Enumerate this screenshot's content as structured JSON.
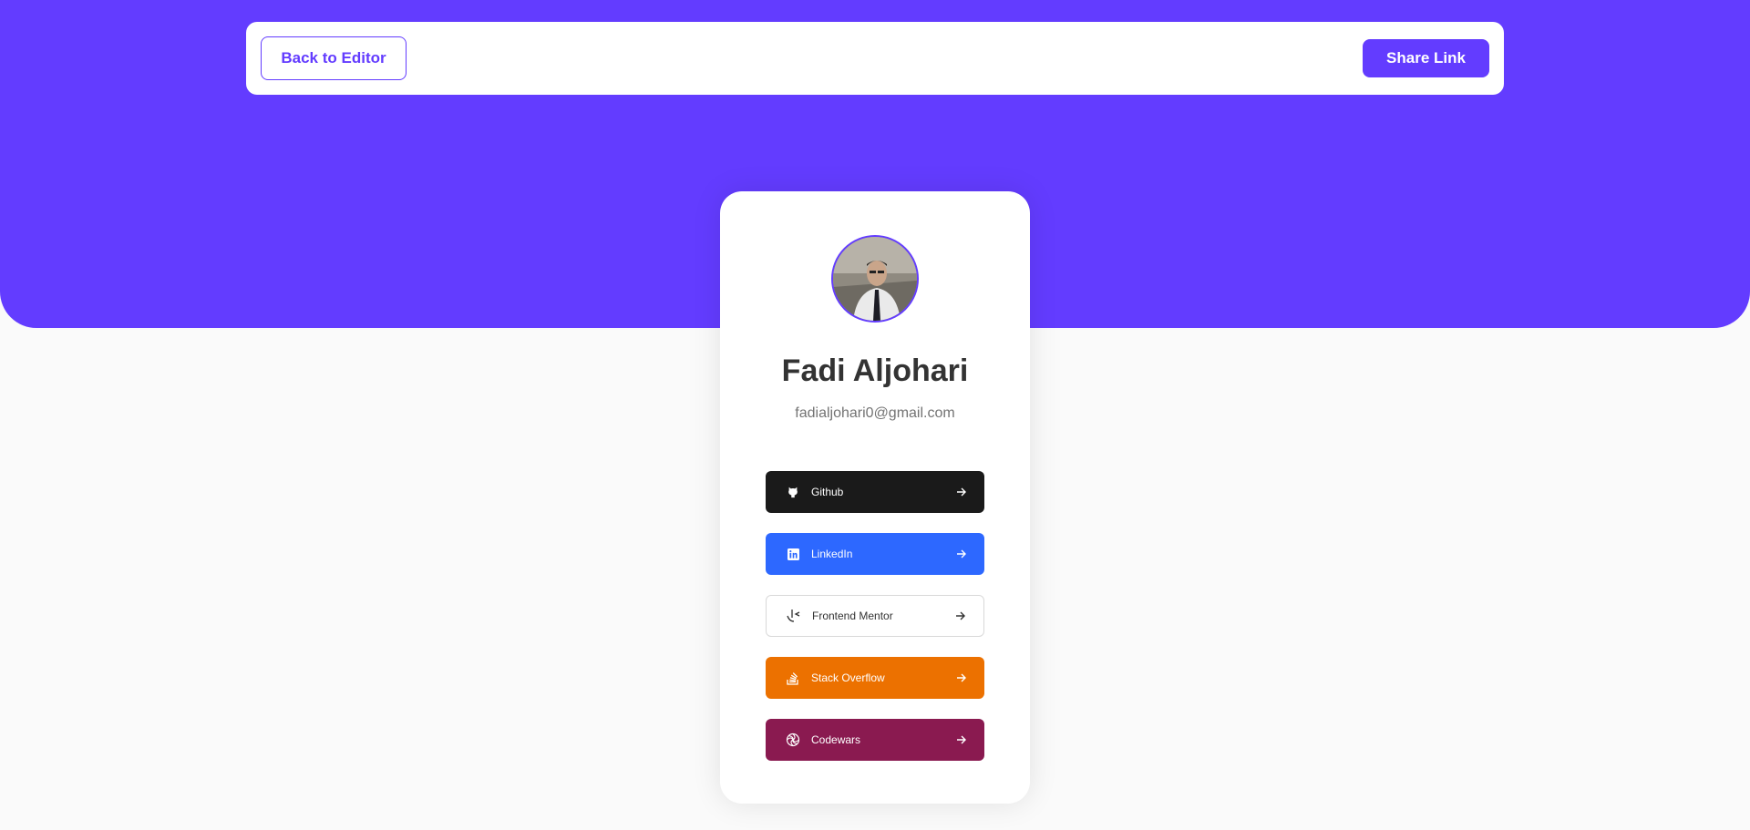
{
  "nav": {
    "back_label": "Back to Editor",
    "share_label": "Share Link"
  },
  "profile": {
    "name": "Fadi Aljohari",
    "email": "fadialjohari0@gmail.com"
  },
  "links": [
    {
      "label": "Github",
      "icon": "github-icon",
      "bg": "#1a1a1a",
      "fg": "#ffffff"
    },
    {
      "label": "LinkedIn",
      "icon": "linkedin-icon",
      "bg": "#2d68ff",
      "fg": "#ffffff"
    },
    {
      "label": "Frontend Mentor",
      "icon": "frontend-mentor-icon",
      "bg": "#ffffff",
      "fg": "#333333"
    },
    {
      "label": "Stack Overflow",
      "icon": "stack-overflow-icon",
      "bg": "#ec7100",
      "fg": "#ffffff"
    },
    {
      "label": "Codewars",
      "icon": "codewars-icon",
      "bg": "#8a1a50",
      "fg": "#ffffff"
    }
  ],
  "colors": {
    "accent": "#633cff",
    "page_bg": "#fafafa"
  }
}
